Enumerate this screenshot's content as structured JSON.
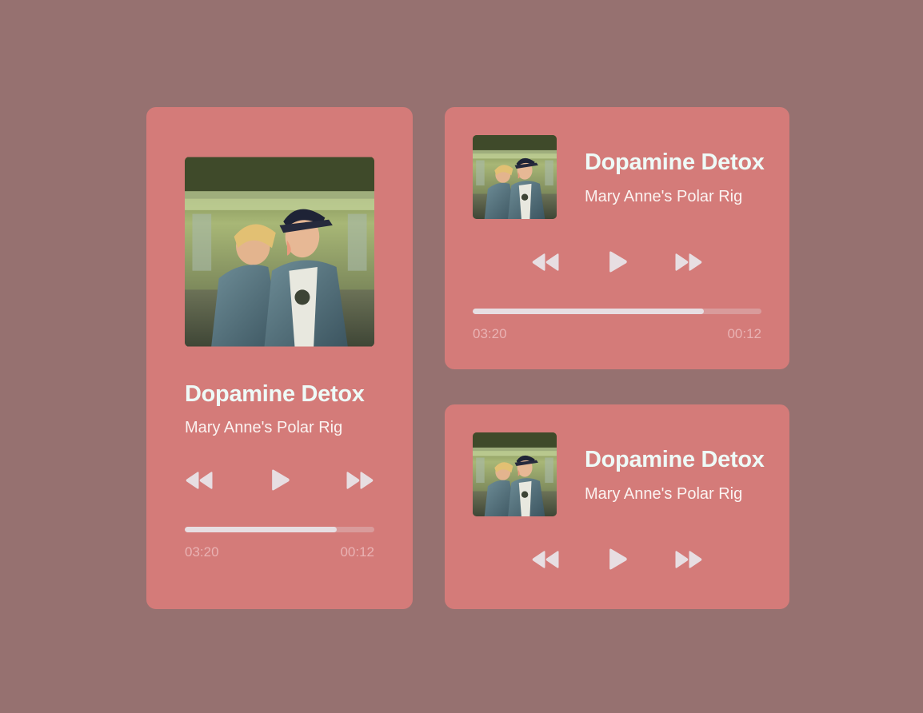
{
  "theme": {
    "background": "#967170",
    "card_color": "#d47b79",
    "title_color": "#eefaf7",
    "control_color": "#e7dee2"
  },
  "players": [
    {
      "variant": "large",
      "title": "Dopamine Detox",
      "artist": "Mary Anne's Polar Rig",
      "elapsed": "03:20",
      "remaining": "00:12",
      "progress": 0.8,
      "controls": [
        "rewind-icon",
        "play-icon",
        "fast-forward-icon"
      ]
    },
    {
      "variant": "compact-with-progress",
      "title": "Dopamine Detox",
      "artist": "Mary Anne's Polar Rig",
      "elapsed": "03:20",
      "remaining": "00:12",
      "progress": 0.8,
      "controls": [
        "rewind-icon",
        "play-icon",
        "fast-forward-icon"
      ]
    },
    {
      "variant": "compact",
      "title": "Dopamine Detox",
      "artist": "Mary Anne's Polar Rig",
      "controls": [
        "rewind-icon",
        "play-icon",
        "fast-forward-icon"
      ]
    }
  ]
}
